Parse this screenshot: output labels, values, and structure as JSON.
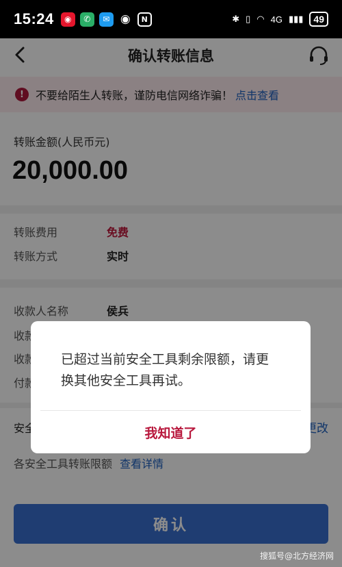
{
  "status_bar": {
    "time": "15:24",
    "network_label": "4G",
    "battery": "49"
  },
  "nav": {
    "title": "确认转账信息"
  },
  "warning": {
    "text": "不要给陌生人转账，谨防电信网络诈骗！",
    "link": "点击查看"
  },
  "amount": {
    "label": "转账金额(人民币元)",
    "value": "20,000.00"
  },
  "fees": [
    {
      "key": "转账费用",
      "value": "免费"
    },
    {
      "key": "转账方式",
      "value": "实时"
    }
  ],
  "payee": [
    {
      "key": "收款人名称",
      "value": "侯兵"
    },
    {
      "key": "收款",
      "value": ""
    },
    {
      "key": "收款",
      "value": ""
    },
    {
      "key": "付款",
      "value": ""
    }
  ],
  "security": {
    "label": "安全工具",
    "change": "更改"
  },
  "limit_row": {
    "label": "各安全工具转账限额",
    "link": "查看详情"
  },
  "confirm_button": "确认",
  "dialog": {
    "message": "已超过当前安全工具剩余限额，请更换其他安全工具再试。",
    "ok": "我知道了"
  },
  "watermark": "搜狐号@北方经济网",
  "colors": {
    "accent_red": "#c0183c",
    "link_blue": "#1d5fbf",
    "button_blue": "#3a6fd0"
  },
  "icons": [
    "back-arrow-icon",
    "headset-icon",
    "warning-icon"
  ]
}
